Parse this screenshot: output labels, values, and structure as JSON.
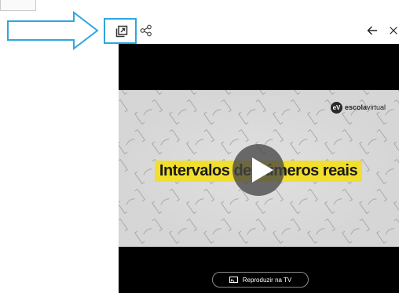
{
  "video": {
    "brand": {
      "bold": "escola",
      "light": "virtual",
      "mark": "eV"
    },
    "title": "Intervalos de números reais"
  },
  "controls": {
    "cast_label": "Reproduzir na TV"
  },
  "icons": [
    "popout-icon",
    "share-icon",
    "back-arrow-icon",
    "close-icon",
    "play-icon",
    "cast-icon"
  ],
  "colors": {
    "highlight": "#2fa6e0",
    "title_band": "#f2de2c",
    "player_bg": "#000000"
  }
}
